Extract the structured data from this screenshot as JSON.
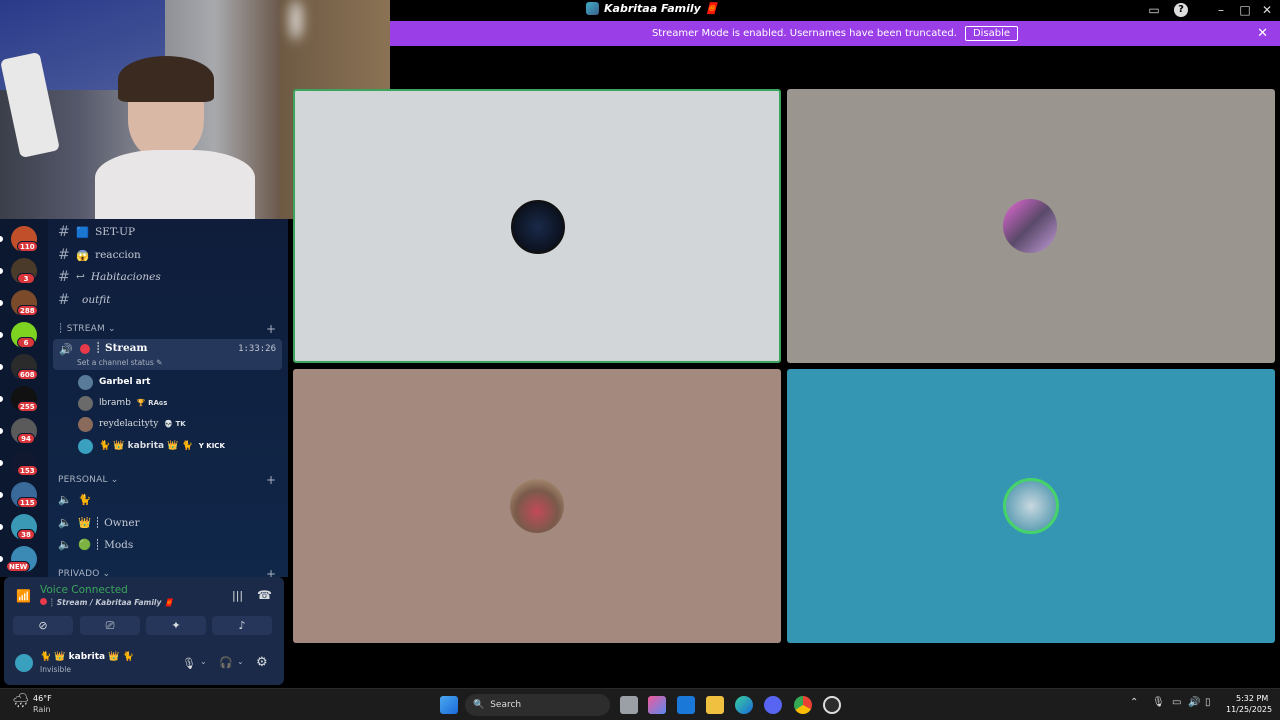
{
  "window": {
    "title": "Kabritaa Family 🧧"
  },
  "banner": {
    "message": "Streamer Mode is enabled. Usernames have been truncated.",
    "disable_label": "Disable"
  },
  "servers": [
    {
      "badge": "110",
      "color": "#c1502a"
    },
    {
      "badge": "3",
      "color": "#4a3a2a"
    },
    {
      "badge": "288",
      "color": "#7a4a2a"
    },
    {
      "badge": "6",
      "color": "#7ed321"
    },
    {
      "badge": "608",
      "color": "#2b2b2b"
    },
    {
      "badge": "255",
      "color": "#111111"
    },
    {
      "badge": "94",
      "color": "#5a5a5a"
    },
    {
      "badge": "153",
      "color": "#101830"
    },
    {
      "badge": "115",
      "color": "#3a6a9a"
    },
    {
      "badge": "38",
      "color": "#3a9ab5"
    },
    {
      "badge": "NEW",
      "color": "#3a8ab5"
    }
  ],
  "channels": {
    "text": [
      {
        "emoji": "🟦",
        "name": "SET-UP"
      },
      {
        "emoji": "😱",
        "name": "reaccion"
      },
      {
        "emoji": "↩",
        "name": "Habitaciones"
      },
      {
        "emoji": "",
        "name": "outfit"
      }
    ],
    "stream_category": "STREAM",
    "stream_channel": {
      "name": "Stream",
      "timer": "1:33:26",
      "status": "Set a channel status"
    },
    "stream_users": [
      {
        "name": "Garbel art",
        "tag": "",
        "color": "#5a7a9a"
      },
      {
        "name": "lbramb",
        "tag": "🏆 RAɢs",
        "color": "#6a6a6a"
      },
      {
        "name": "reydelacityty",
        "tag": "💀 TK",
        "color": "#8a6a5a"
      },
      {
        "name": "🐈 👑 kabrita 👑 🐈",
        "tag": "Y KICK",
        "color": "#3aa0c0"
      }
    ],
    "personal_category": "PERSONAL",
    "personal_channels": [
      {
        "name": "🐈"
      },
      {
        "name": "👑 ┊ Owner"
      },
      {
        "name": "🟢 ┊ Mods"
      }
    ],
    "private_category": "PRIVADO"
  },
  "voice": {
    "status": "Voice Connected",
    "location": "┊ Stream / Kabritaa Family 🧧",
    "user_name": "🐈 👑 kabrita 👑 🐈",
    "user_status": "Invisible"
  },
  "tiles": [
    {
      "bg": "#d2d6d8",
      "speaking": true
    },
    {
      "bg": "#9b958f",
      "speaking": false
    },
    {
      "bg": "#a48a7e",
      "speaking": false
    },
    {
      "bg": "#3596b3",
      "speaking": false
    }
  ],
  "taskbar": {
    "weather_temp": "46°F",
    "weather_desc": "Rain",
    "search_label": "Search",
    "time": "5:32 PM",
    "date": "11/25/2025"
  }
}
